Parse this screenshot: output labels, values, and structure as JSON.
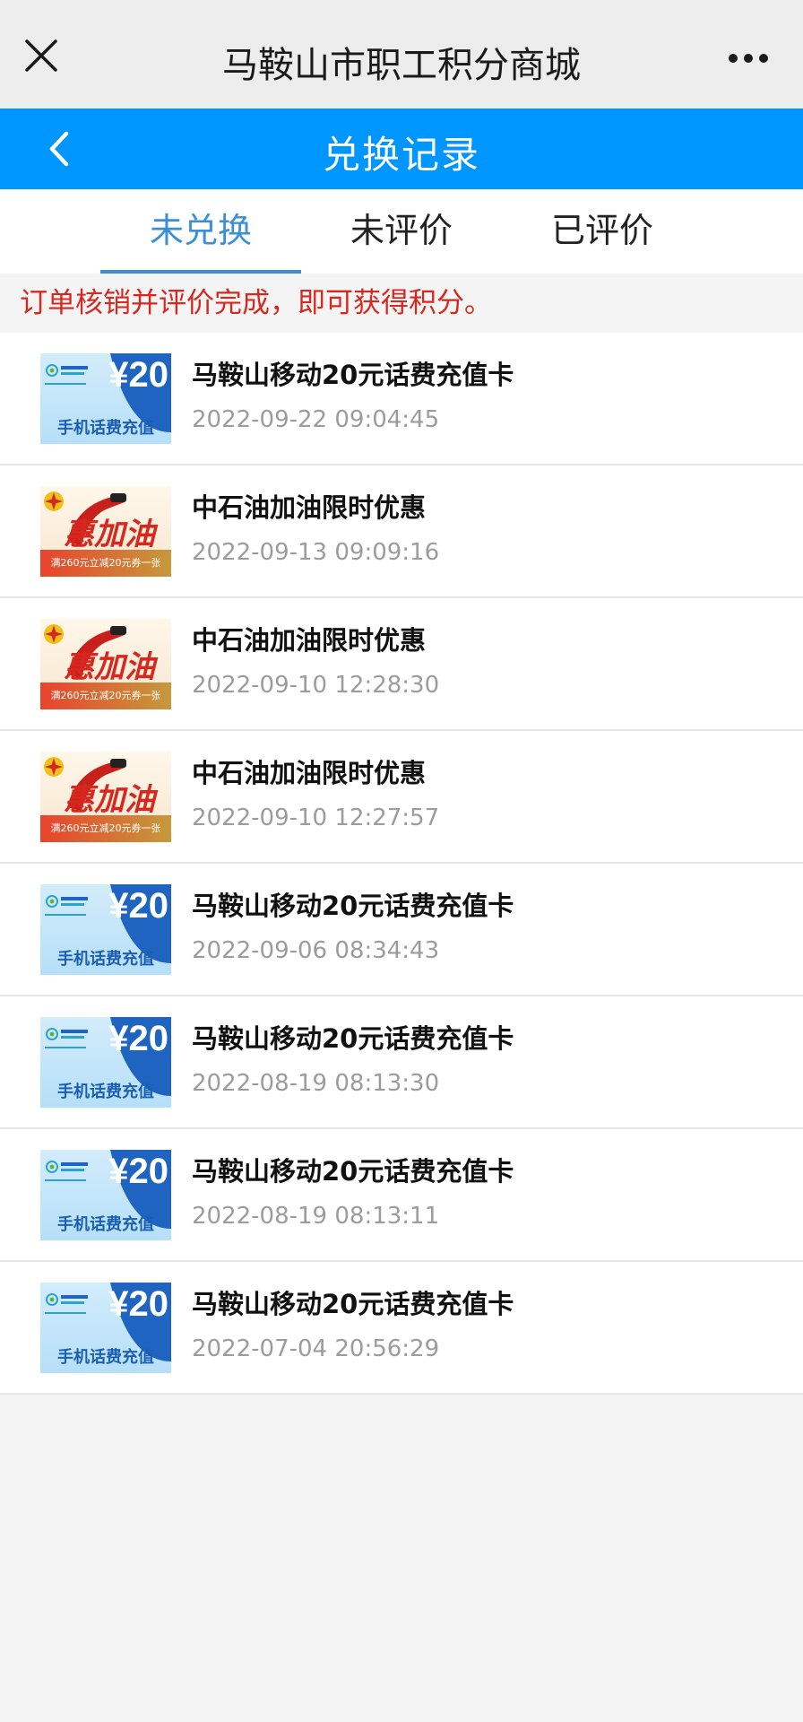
{
  "titlebar": {
    "title": "马鞍山市职工积分商城"
  },
  "header": {
    "title": "兑换记录"
  },
  "tabs": [
    {
      "label": "未兑换",
      "active": true
    },
    {
      "label": "未评价",
      "active": false
    },
    {
      "label": "已评价",
      "active": false
    }
  ],
  "notice": "订单核销并评价完成，即可获得积分。",
  "colors": {
    "accent": "#0096ff",
    "tab_active": "#3b8fd6",
    "notice": "#d7281f"
  },
  "orders": [
    {
      "type": "mobile",
      "name": "马鞍山移动20元话费充值卡",
      "time": "2022-09-22 09:04:45",
      "thumb": {
        "price": "¥20",
        "label": "手机话费充值"
      }
    },
    {
      "type": "fuel",
      "name": "中石油加油限时优惠",
      "time": "2022-09-13 09:09:16",
      "thumb": {
        "big": "惠加油",
        "strip": "满260元立减20元券一张"
      }
    },
    {
      "type": "fuel",
      "name": "中石油加油限时优惠",
      "time": "2022-09-10 12:28:30",
      "thumb": {
        "big": "惠加油",
        "strip": "满260元立减20元券一张"
      }
    },
    {
      "type": "fuel",
      "name": "中石油加油限时优惠",
      "time": "2022-09-10 12:27:57",
      "thumb": {
        "big": "惠加油",
        "strip": "满260元立减20元券一张"
      }
    },
    {
      "type": "mobile",
      "name": "马鞍山移动20元话费充值卡",
      "time": "2022-09-06 08:34:43",
      "thumb": {
        "price": "¥20",
        "label": "手机话费充值"
      }
    },
    {
      "type": "mobile",
      "name": "马鞍山移动20元话费充值卡",
      "time": "2022-08-19 08:13:30",
      "thumb": {
        "price": "¥20",
        "label": "手机话费充值"
      }
    },
    {
      "type": "mobile",
      "name": "马鞍山移动20元话费充值卡",
      "time": "2022-08-19 08:13:11",
      "thumb": {
        "price": "¥20",
        "label": "手机话费充值"
      }
    },
    {
      "type": "mobile",
      "name": "马鞍山移动20元话费充值卡",
      "time": "2022-07-04 20:56:29",
      "thumb": {
        "price": "¥20",
        "label": "手机话费充值"
      }
    }
  ]
}
